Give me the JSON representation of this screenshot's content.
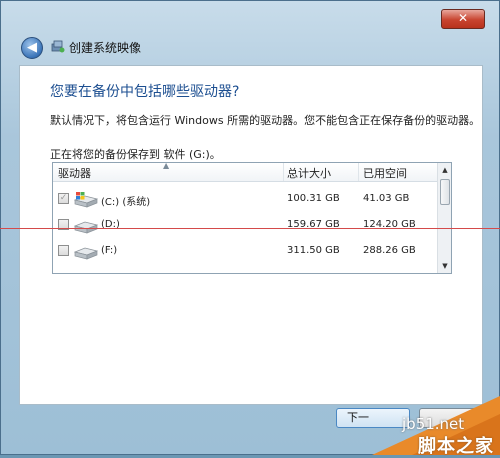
{
  "window": {
    "title": "创建系统映像",
    "close_glyph": "✕",
    "back_glyph": "◀"
  },
  "content": {
    "heading": "您要在备份中包括哪些驱动器?",
    "description": "默认情况下，将包含运行 Windows 所需的驱动器。您不能包含正在保存备份的驱动器。",
    "saving_to": "正在将您的备份保存到 软件 (G:)。"
  },
  "table": {
    "headers": [
      "驱动器",
      "总计大小",
      "已用空间"
    ],
    "rows": [
      {
        "drive": "(C:) (系统)",
        "total": "100.31 GB",
        "used": "41.03 GB",
        "checked": true,
        "disabled": true,
        "icon": "windows-drive-icon"
      },
      {
        "drive": "(D:)",
        "total": "159.67 GB",
        "used": "124.20 GB",
        "checked": false,
        "disabled": false,
        "icon": "drive-icon"
      },
      {
        "drive": "(F:)",
        "total": "311.50 GB",
        "used": "288.26 GB",
        "checked": false,
        "disabled": false,
        "icon": "drive-icon"
      }
    ]
  },
  "buttons": {
    "next_label": "下一"
  },
  "watermark": {
    "site": "jb51.net",
    "name": "脚本之家"
  },
  "colors": {
    "heading": "#1d4f91",
    "close": "#c8442f",
    "chrome": "#a9c6db",
    "annotation_line": "#d44a4a"
  }
}
